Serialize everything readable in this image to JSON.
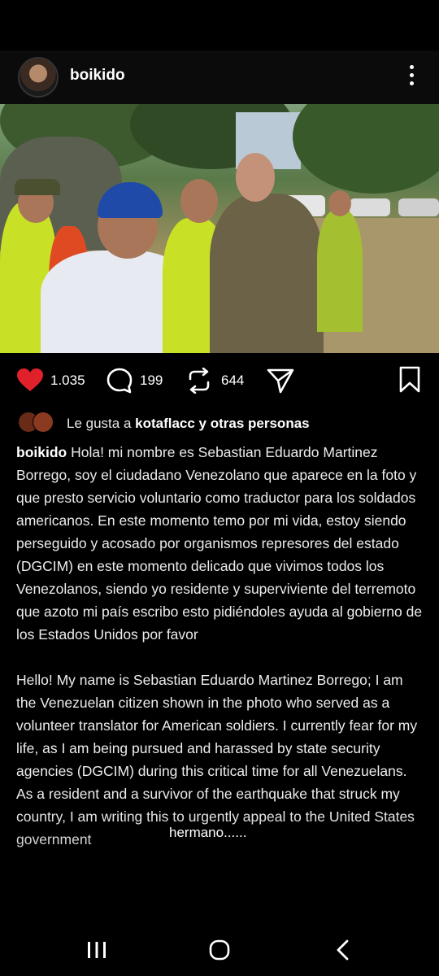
{
  "post": {
    "username": "boikido"
  },
  "actions": {
    "likes_count": "1.035",
    "comments_count": "199",
    "reposts_count": "644"
  },
  "likes_line": {
    "prefix": "Le gusta a ",
    "user": "kotaflacc",
    "suffix": " y otras personas"
  },
  "caption": {
    "username": "boikido",
    "spanish": " Hola! mi nombre es Sebastian Eduardo Martinez Borrego, soy el ciudadano Venezolano que aparece en la foto y que presto servicio voluntario como traductor para los soldados americanos. En este momento temo por mi vida, estoy siendo perseguido y acosado por organismos represores del estado (DGCIM) en este momento delicado que vivimos todos los Venezolanos, siendo yo residente y superviviente del terremoto que azoto mi país escribo esto pidiéndoles ayuda al gobierno de los Estados Unidos por favor",
    "english": "Hello! My name is Sebastian Eduardo Martinez Borrego; I am the Venezuelan citizen shown in the photo who served as a volunteer translator for American soldiers. I currently fear for my life, as I am being pursued and harassed by state security agencies (DGCIM) during this critical time for all Venezuelans. As a resident and a survivor of the earthquake that struck my country, I am writing this to urgently appeal to the United States government"
  },
  "overlay_text": "hermano......",
  "colors": {
    "like_heart": "#e0202a",
    "background": "#000000",
    "text": "#ececec"
  },
  "icons": {
    "more": "more-vertical-icon",
    "heart": "heart-icon",
    "comment": "comment-icon",
    "repost": "repost-icon",
    "share": "send-icon",
    "bookmark": "bookmark-icon",
    "nav_recents": "recents-icon",
    "nav_home": "home-icon",
    "nav_back": "back-icon"
  }
}
